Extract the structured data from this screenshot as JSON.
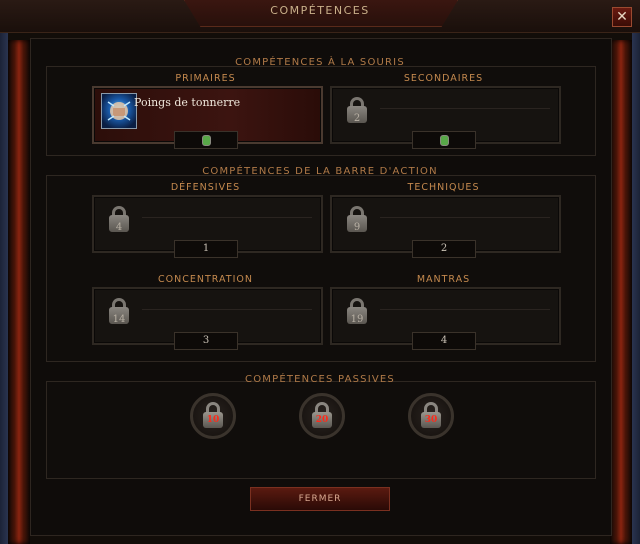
{
  "window": {
    "title": "Compétences",
    "close_label": "✕"
  },
  "mouse_section": {
    "title": "Compétences à la souris",
    "primary_label": "Primaires",
    "secondary_label": "Secondaires",
    "primary_skill_name": "Poings de tonnerre",
    "secondary_unlock_level": "2"
  },
  "action_bar_section": {
    "title": "Compétences de la barre d'action",
    "slots": [
      {
        "label": "Défensives",
        "unlock_level": "4",
        "key": "1"
      },
      {
        "label": "Techniques",
        "unlock_level": "9",
        "key": "2"
      },
      {
        "label": "Concentration",
        "unlock_level": "14",
        "key": "3"
      },
      {
        "label": "Mantras",
        "unlock_level": "19",
        "key": "4"
      }
    ]
  },
  "passive_section": {
    "title": "Compétences passives",
    "slots": [
      {
        "unlock_level": "10"
      },
      {
        "unlock_level": "20"
      },
      {
        "unlock_level": "30"
      }
    ]
  },
  "footer": {
    "close_button_label": "Fermer"
  },
  "colors": {
    "accent": "#c4894e",
    "locked_level": "#ff2a1a",
    "frame_red": "#8a2410"
  }
}
